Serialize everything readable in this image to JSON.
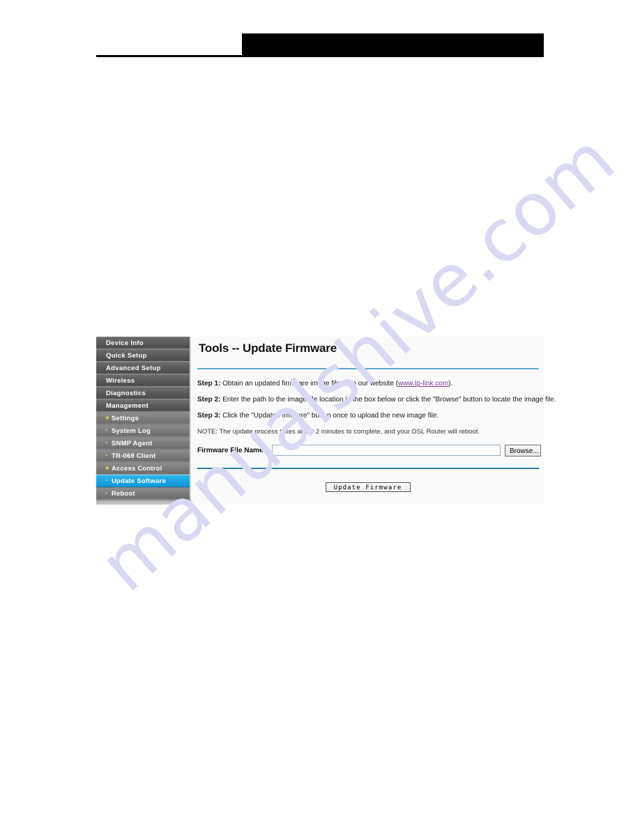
{
  "header": {
    "redaction_label": "redacted-black-bar"
  },
  "watermark": {
    "text": "manualshive.com",
    "color": "#d9d9f3"
  },
  "sidebar": {
    "items": [
      {
        "label": "Device Info",
        "level": "top",
        "marker": "",
        "selected": false
      },
      {
        "label": "Quick Setup",
        "level": "top",
        "marker": "",
        "selected": false
      },
      {
        "label": "Advanced Setup",
        "level": "top",
        "marker": "",
        "selected": false
      },
      {
        "label": "Wireless",
        "level": "top",
        "marker": "",
        "selected": false
      },
      {
        "label": "Diagnostics",
        "level": "top",
        "marker": "",
        "selected": false
      },
      {
        "label": "Management",
        "level": "top",
        "marker": "",
        "selected": false
      },
      {
        "label": "Settings",
        "level": "sub",
        "marker": "+",
        "selected": false
      },
      {
        "label": "System Log",
        "level": "sub",
        "marker": "·",
        "selected": false
      },
      {
        "label": "SNMP Agent",
        "level": "sub",
        "marker": "·",
        "selected": false
      },
      {
        "label": "TR-069 Client",
        "level": "sub",
        "marker": "·",
        "selected": false
      },
      {
        "label": "Access Control",
        "level": "sub",
        "marker": "+",
        "selected": false
      },
      {
        "label": "Update Software",
        "level": "sub",
        "marker": "·",
        "selected": true
      },
      {
        "label": "Reboot",
        "level": "sub",
        "marker": "·",
        "selected": false
      }
    ],
    "selected_color": "#17a3e0",
    "marker_color": "#ffe14d"
  },
  "main": {
    "title": "Tools -- Update Firmware",
    "steps": [
      {
        "label": "Step 1:",
        "text_before": " Obtain an updated firmware image file from our website (",
        "link": "www.tp-link.com",
        "text_after": ")."
      },
      {
        "label": "Step 2:",
        "text_before": " Enter the path to the image file location in the box below or click the \"Browse\" button to locate the image file.",
        "link": "",
        "text_after": ""
      },
      {
        "label": "Step 3:",
        "text_before": " Click the \"Update Firmware\" button once to upload the new image file.",
        "link": "",
        "text_after": ""
      }
    ],
    "note": "NOTE: The update process takes about 2 minutes to complete, and your DSL Router will reboot.",
    "file_field": {
      "label": "Firmware File Name:",
      "value": "",
      "placeholder": ""
    },
    "browse_label": "Browse...",
    "submit_label": "Update Firmware",
    "link_color": "#7b3f9d",
    "divider_color": "#5fa8c9"
  }
}
